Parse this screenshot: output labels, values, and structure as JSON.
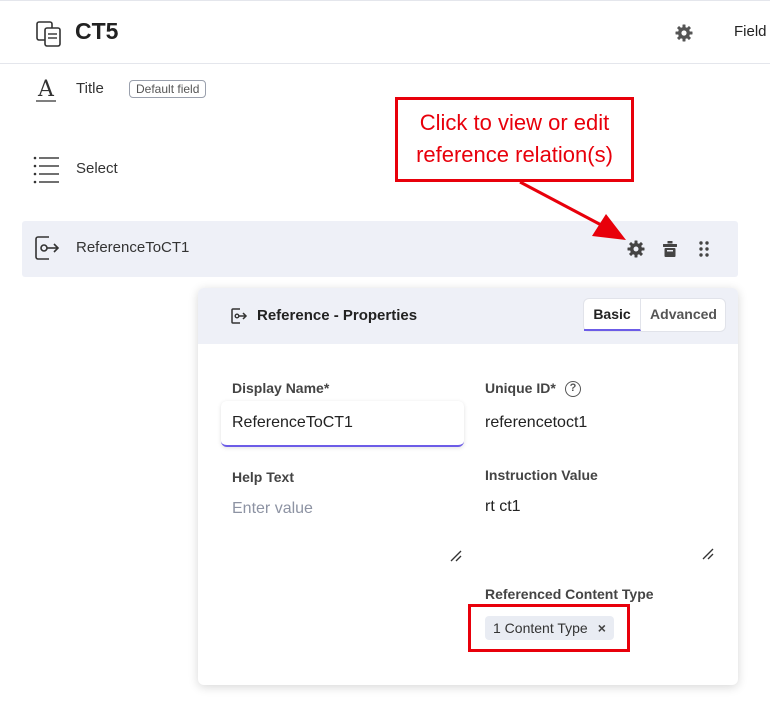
{
  "header": {
    "content_type_title": "CT5",
    "fields_tab_label": "Field"
  },
  "fields": [
    {
      "label": "Title",
      "badge": "Default field",
      "icon": "text-a-icon"
    },
    {
      "label": "Select",
      "icon": "list-icon"
    },
    {
      "label": "ReferenceToCT1",
      "icon": "reference-icon",
      "selected": true
    }
  ],
  "annotation": {
    "line1": "Click to view or edit",
    "line2": "reference relation(s)",
    "color": "#e8000b"
  },
  "panel": {
    "title": "Reference - Properties",
    "tabs": {
      "basic": "Basic",
      "advanced": "Advanced"
    },
    "display_name_label": "Display Name*",
    "display_name_value": "ReferenceToCT1",
    "unique_id_label": "Unique ID*",
    "unique_id_help": "?",
    "unique_id_value": "referencetoct1",
    "help_text_label": "Help Text",
    "help_text_placeholder": "Enter value",
    "instruction_label": "Instruction Value",
    "instruction_value": "rt ct1",
    "referenced_label": "Referenced Content Type",
    "referenced_chip": "1 Content Type",
    "chip_remove": "×"
  },
  "colors": {
    "accent": "#6c5ce7",
    "highlight": "#e8000b",
    "row_selected": "#eef0f7"
  }
}
